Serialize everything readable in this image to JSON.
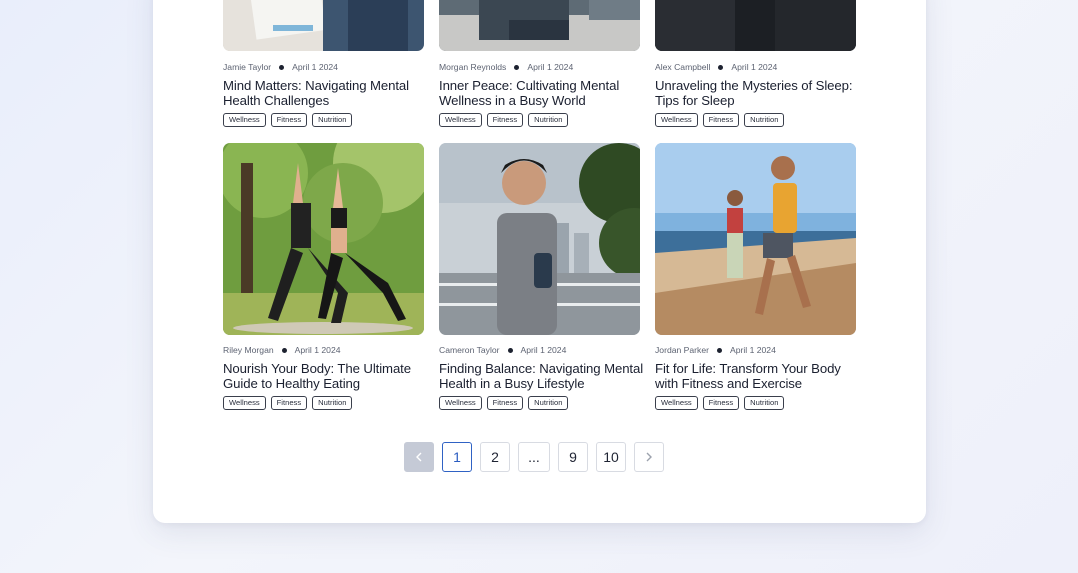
{
  "posts": [
    {
      "author": "Jamie Taylor",
      "date": "April 1 2024",
      "title": "Mind Matters: Navigating Mental Health Challenges",
      "tags": [
        "Wellness",
        "Fitness",
        "Nutrition"
      ]
    },
    {
      "author": "Morgan Reynolds",
      "date": "April 1 2024",
      "title": "Inner Peace: Cultivating Mental Wellness in a Busy World",
      "tags": [
        "Wellness",
        "Fitness",
        "Nutrition"
      ]
    },
    {
      "author": "Alex Campbell",
      "date": "April 1 2024",
      "title": "Unraveling the Mysteries of Sleep: Tips for Sleep",
      "tags": [
        "Wellness",
        "Fitness",
        "Nutrition"
      ]
    },
    {
      "author": "Riley Morgan",
      "date": "April 1 2024",
      "title": "Nourish Your Body: The Ultimate Guide to Healthy Eating",
      "tags": [
        "Wellness",
        "Fitness",
        "Nutrition"
      ]
    },
    {
      "author": "Cameron Taylor",
      "date": "April 1 2024",
      "title": "Finding Balance: Navigating Mental Health in a Busy Lifestyle",
      "tags": [
        "Wellness",
        "Fitness",
        "Nutrition"
      ]
    },
    {
      "author": "Jordan Parker",
      "date": "April 1 2024",
      "title": "Fit for Life: Transform Your Body with Fitness and Exercise",
      "tags": [
        "Wellness",
        "Fitness",
        "Nutrition"
      ]
    }
  ],
  "pagination": {
    "prev_icon": "chevron-left-icon",
    "next_icon": "chevron-right-icon",
    "pages": [
      "1",
      "2",
      "...",
      "9",
      "10"
    ],
    "current": "1"
  },
  "colors": {
    "accent": "#2f62c4",
    "prev_disabled": "#c5cad6"
  }
}
